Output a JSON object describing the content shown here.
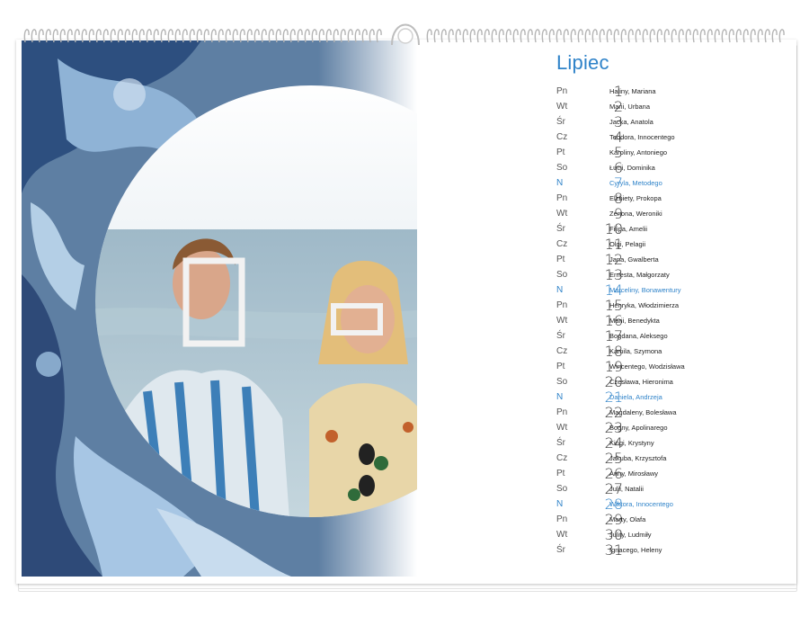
{
  "calendar": {
    "month": "Lipiec",
    "accent_color": "#2f83c9",
    "days": [
      {
        "dow": "Pn",
        "day": "1",
        "names": "Haliny, Mariana",
        "sunday": false
      },
      {
        "dow": "Wt",
        "day": "2",
        "names": "Marii, Urbana",
        "sunday": false
      },
      {
        "dow": "Śr",
        "day": "3",
        "names": "Jacka, Anatola",
        "sunday": false
      },
      {
        "dow": "Cz",
        "day": "4",
        "names": "Teodora, Innocentego",
        "sunday": false
      },
      {
        "dow": "Pt",
        "day": "5",
        "names": "Karoliny, Antoniego",
        "sunday": false
      },
      {
        "dow": "So",
        "day": "6",
        "names": "Łucji, Dominika",
        "sunday": false
      },
      {
        "dow": "N",
        "day": "7",
        "names": "Cyryla, Metodego",
        "sunday": true
      },
      {
        "dow": "Pn",
        "day": "8",
        "names": "Elżbiety, Prokopa",
        "sunday": false
      },
      {
        "dow": "Wt",
        "day": "9",
        "names": "Zenona, Weroniki",
        "sunday": false
      },
      {
        "dow": "Śr",
        "day": "10",
        "names": "Filipa, Amelii",
        "sunday": false
      },
      {
        "dow": "Cz",
        "day": "11",
        "names": "Olgi, Pelagii",
        "sunday": false
      },
      {
        "dow": "Pt",
        "day": "12",
        "names": "Jana, Gwalberta",
        "sunday": false
      },
      {
        "dow": "So",
        "day": "13",
        "names": "Ernesta, Małgorzaty",
        "sunday": false
      },
      {
        "dow": "N",
        "day": "14",
        "names": "Marceliny, Bonawentury",
        "sunday": true
      },
      {
        "dow": "Pn",
        "day": "15",
        "names": "Henryka, Włodzimierza",
        "sunday": false
      },
      {
        "dow": "Wt",
        "day": "16",
        "names": "Marii, Benedykta",
        "sunday": false
      },
      {
        "dow": "Śr",
        "day": "17",
        "names": "Bogdana, Aleksego",
        "sunday": false
      },
      {
        "dow": "Cz",
        "day": "18",
        "names": "Kamila, Szymona",
        "sunday": false
      },
      {
        "dow": "Pt",
        "day": "19",
        "names": "Wincentego, Wodzisława",
        "sunday": false
      },
      {
        "dow": "So",
        "day": "20",
        "names": "Czesława, Hieronima",
        "sunday": false
      },
      {
        "dow": "N",
        "day": "21",
        "names": "Daniela, Andrzeja",
        "sunday": true
      },
      {
        "dow": "Pn",
        "day": "22",
        "names": "Magdaleny, Bolesława",
        "sunday": false
      },
      {
        "dow": "Wt",
        "day": "23",
        "names": "Bogny, Apolinarego",
        "sunday": false
      },
      {
        "dow": "Śr",
        "day": "24",
        "names": "Kingi, Krystyny",
        "sunday": false
      },
      {
        "dow": "Cz",
        "day": "25",
        "names": "Jakuba, Krzysztofa",
        "sunday": false
      },
      {
        "dow": "Pt",
        "day": "26",
        "names": "Anny, Mirosławy",
        "sunday": false
      },
      {
        "dow": "So",
        "day": "27",
        "names": "Julii, Natalii",
        "sunday": false
      },
      {
        "dow": "N",
        "day": "28",
        "names": "Wiktora, Innocentego",
        "sunday": true
      },
      {
        "dow": "Pn",
        "day": "29",
        "names": "Marty, Olafa",
        "sunday": false
      },
      {
        "dow": "Wt",
        "day": "30",
        "names": "Julity, Ludmiły",
        "sunday": false
      },
      {
        "dow": "Śr",
        "day": "31",
        "names": "Ignacego, Heleny",
        "sunday": false
      }
    ]
  },
  "photo": {
    "icon": "beach-portrait-photo"
  }
}
